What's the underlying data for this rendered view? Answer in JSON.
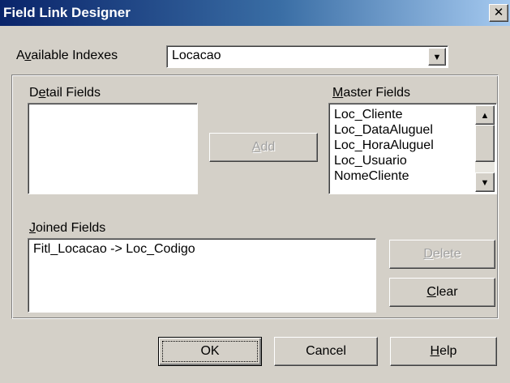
{
  "window": {
    "title": "Field Link Designer",
    "close_glyph": "✕"
  },
  "available_indexes": {
    "label_pre": "A",
    "label_accel": "v",
    "label_post": "ailable Indexes",
    "selected": "Locacao"
  },
  "detail_fields": {
    "label_pre": "D",
    "label_accel": "e",
    "label_post": "tail Fields",
    "items": []
  },
  "master_fields": {
    "label_pre": "",
    "label_accel": "M",
    "label_post": "aster Fields",
    "items": [
      "Loc_Cliente",
      "Loc_DataAluguel",
      "Loc_HoraAluguel",
      "Loc_Usuario",
      "NomeCliente"
    ]
  },
  "add_button": {
    "label_pre": "",
    "label_accel": "A",
    "label_post": "dd"
  },
  "joined_fields": {
    "label_pre": "",
    "label_accel": "J",
    "label_post": "oined Fields",
    "items": [
      "Fitl_Locacao -> Loc_Codigo"
    ]
  },
  "delete_button": {
    "label_pre": "",
    "label_accel": "D",
    "label_post": "elete"
  },
  "clear_button": {
    "label_pre": "",
    "label_accel": "C",
    "label_post": "lear"
  },
  "footer": {
    "ok_label": "OK",
    "cancel_label": "Cancel",
    "help_pre": "",
    "help_accel": "H",
    "help_post": "elp"
  },
  "icons": {
    "dropdown": "down-triangle-icon",
    "scroll_up": "up-triangle-icon",
    "scroll_down": "down-triangle-icon"
  }
}
